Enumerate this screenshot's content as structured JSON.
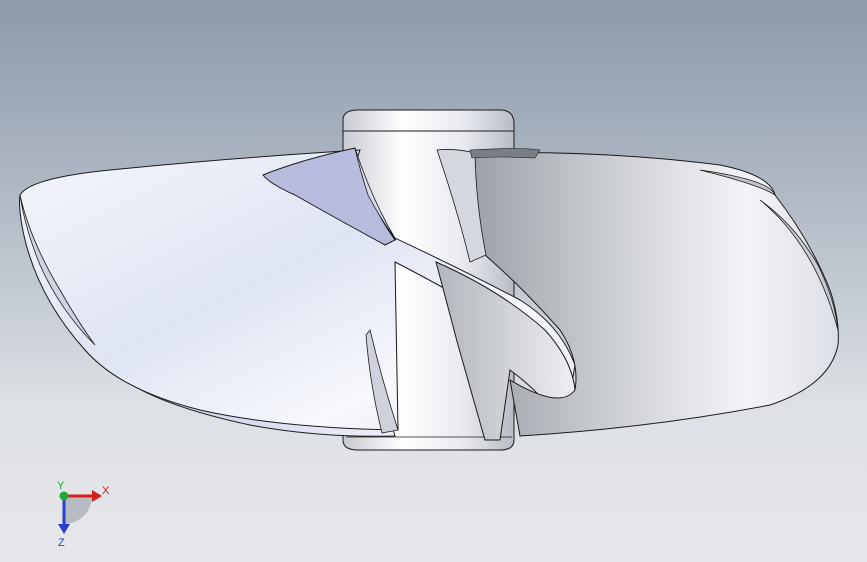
{
  "viewport": {
    "model": "propeller",
    "background_top": "#8d9aab",
    "background_bottom": "#e6e7ea"
  },
  "triad": {
    "x_label": "X",
    "y_label": "Y",
    "z_label": "Z",
    "x_color": "#d81e1e",
    "y_color": "#1fa83a",
    "z_color": "#2a3fd0"
  }
}
